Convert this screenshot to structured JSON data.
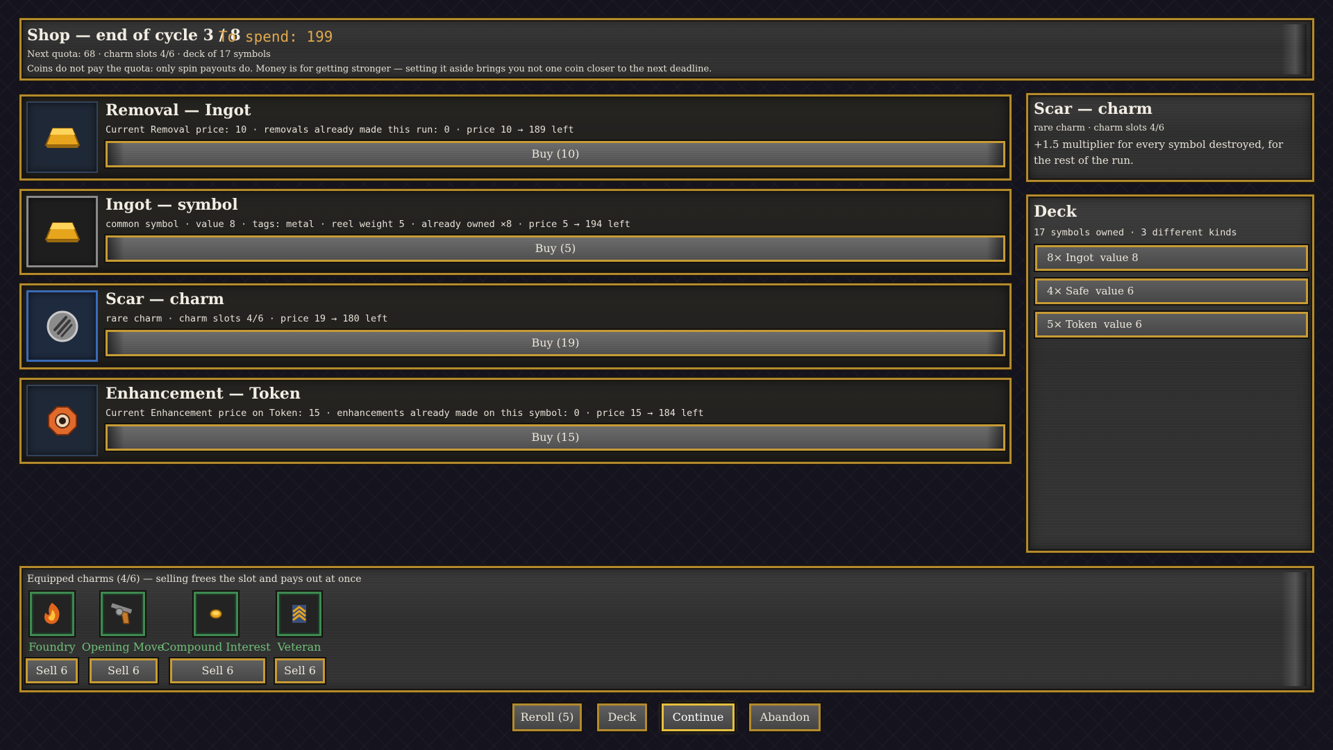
{
  "header": {
    "title": "Shop — end of cycle 3 / 8",
    "to_spend": "To spend: 199",
    "subtitle": "Next quota: 68 · charm slots 4/6 · deck of 17 symbols",
    "note": "Coins do not pay the quota: only spin payouts do. Money is for getting stronger — setting it aside brings you not one coin closer to the next deadline."
  },
  "offers": [
    {
      "title": "Removal — Ingot",
      "description": "Current Removal price: 10 · removals already made this run: 0 · price 10 → 189 left",
      "button": "Buy (10)",
      "icon": "gold-ingot-icon"
    },
    {
      "title": "Ingot — symbol",
      "description": "common symbol · value 8 · tags: metal · reel weight 5 · already owned ×8 · price 5 → 194 left",
      "button": "Buy (5)",
      "icon": "gold-ingot-icon"
    },
    {
      "title": "Scar — charm",
      "description": "rare charm · charm slots 4/6 · price 19 → 180 left",
      "button": "Buy (19)",
      "icon": "scar-icon"
    },
    {
      "title": "Enhancement — Token",
      "description": "Current Enhancement price on Token: 15 · enhancements already made on this symbol: 0 · price 15 → 184 left",
      "button": "Buy (15)",
      "icon": "token-icon"
    }
  ],
  "detail": {
    "title": "Scar — charm",
    "subtitle": "rare charm · charm slots 4/6",
    "text": "+1.5 multiplier for every symbol destroyed, for the rest of the run."
  },
  "deck": {
    "title": "Deck",
    "summary": "17 symbols owned · 3 different kinds",
    "items": [
      "8× Ingot  value 8",
      "4× Safe  value 6",
      "5× Token  value 6"
    ]
  },
  "charms": {
    "title": "Equipped charms (4/6) — selling frees the slot and pays out at once",
    "items": [
      {
        "name": "Foundry",
        "sell": "Sell 6",
        "icon": "foundry-icon"
      },
      {
        "name": "Opening Move",
        "sell": "Sell 6",
        "icon": "revolver-icon"
      },
      {
        "name": "Compound Interest",
        "sell": "Sell 6",
        "icon": "coin-icon"
      },
      {
        "name": "Veteran",
        "sell": "Sell 6",
        "icon": "chevron-rank-icon"
      }
    ]
  },
  "actions": {
    "reroll": "Reroll (5)",
    "deck": "Deck",
    "continue": "Continue",
    "abandon": "Abandon"
  },
  "colors": {
    "gold_border": "#b48a2c",
    "spend": "#e3a94c",
    "charm_name": "#6fbf78",
    "charm_border": "#3f8a52",
    "rare_border": "#3a6bb8"
  }
}
